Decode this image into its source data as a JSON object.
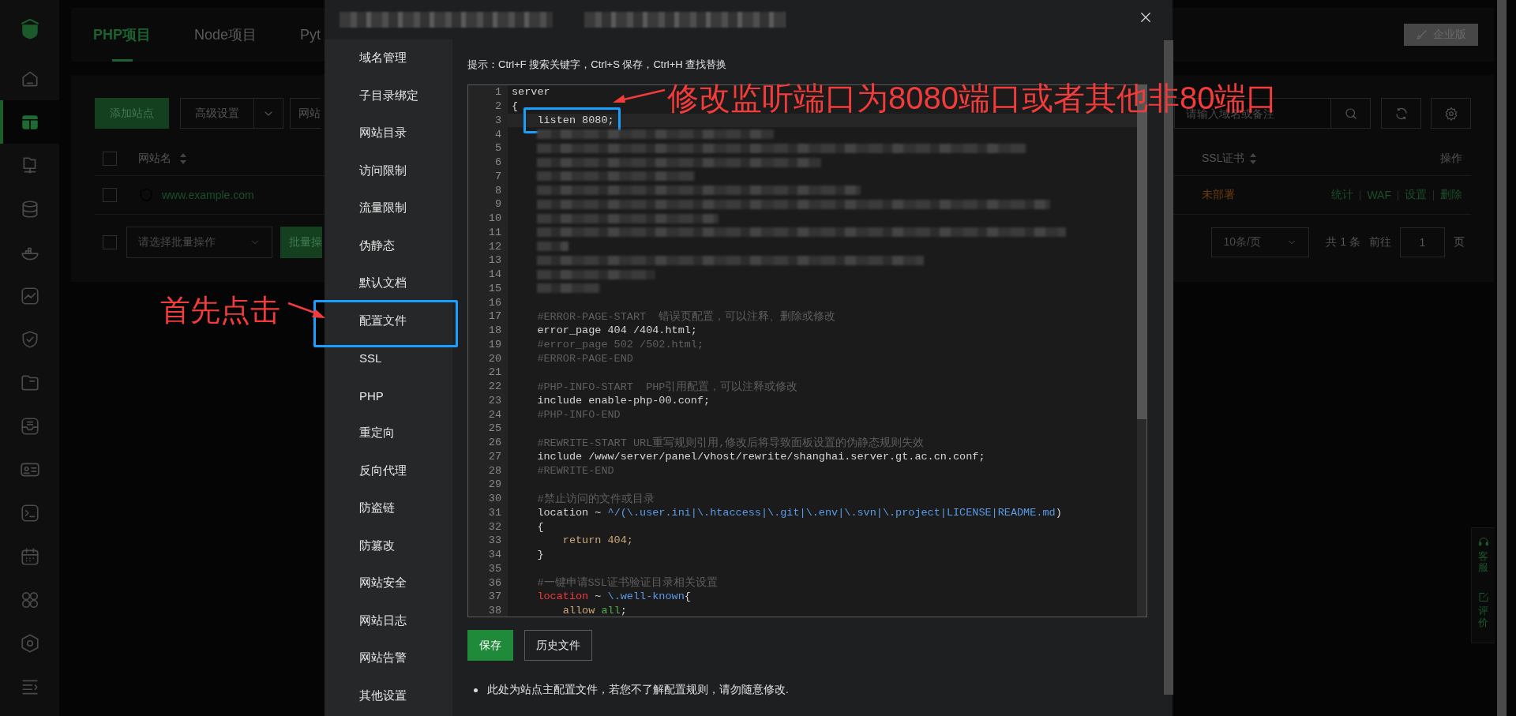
{
  "sidebar": {
    "items": [
      {
        "selected": false
      },
      {
        "selected": true
      },
      {
        "selected": false
      },
      {
        "selected": false
      },
      {
        "selected": false
      },
      {
        "selected": false
      },
      {
        "selected": false
      },
      {
        "selected": false
      },
      {
        "selected": false
      },
      {
        "selected": false
      },
      {
        "selected": false
      },
      {
        "selected": false
      },
      {
        "selected": false
      },
      {
        "selected": false
      },
      {
        "selected": false
      }
    ]
  },
  "tabs": [
    {
      "label": "PHP项目",
      "selected": true
    },
    {
      "label": "Node项目",
      "selected": false
    },
    {
      "label": "Pyt",
      "selected": false
    }
  ],
  "edition_button": "企业版",
  "toolbar": {
    "buttons": [
      "添加站点",
      "高级设置",
      "网站"
    ],
    "search": {
      "placeholder": "请输入域名或备注"
    }
  },
  "table": {
    "header_checked": false,
    "columns": [
      "网站名",
      "SSL证书",
      "操作"
    ],
    "rows": [
      {
        "checked": false,
        "name": "www.example.com",
        "ssl": "未部署",
        "actions": [
          "统计",
          "WAF",
          "设置",
          "删除"
        ]
      }
    ]
  },
  "batch": {
    "checked": false,
    "select_placeholder": "请选择批量操作",
    "button": "批量操"
  },
  "pagination": {
    "page_size": "10条/页",
    "total": "共 1 条",
    "goto_label": "前往",
    "page": "1",
    "page_suffix": "页"
  },
  "float_panel": [
    {
      "label": "客服"
    },
    {
      "label": "评价"
    }
  ],
  "modal": {
    "menu": [
      {
        "label": "域名管理",
        "highlighted": false
      },
      {
        "label": "子目录绑定",
        "highlighted": false
      },
      {
        "label": "网站目录",
        "highlighted": false
      },
      {
        "label": "访问限制",
        "highlighted": false
      },
      {
        "label": "流量限制",
        "highlighted": false
      },
      {
        "label": "伪静态",
        "highlighted": false
      },
      {
        "label": "默认文档",
        "highlighted": false
      },
      {
        "label": "配置文件",
        "highlighted": true
      },
      {
        "label": "SSL",
        "highlighted": false
      },
      {
        "label": "PHP",
        "highlighted": false
      },
      {
        "label": "重定向",
        "highlighted": false
      },
      {
        "label": "反向代理",
        "highlighted": false
      },
      {
        "label": "防盗链",
        "highlighted": false
      },
      {
        "label": "防篡改",
        "highlighted": false
      },
      {
        "label": "网站安全",
        "highlighted": false
      },
      {
        "label": "网站日志",
        "highlighted": false
      },
      {
        "label": "网站告警",
        "highlighted": false
      },
      {
        "label": "其他设置",
        "highlighted": false
      }
    ],
    "hint": "提示：Ctrl+F 搜索关键字，Ctrl+S 保存，Ctrl+H 查找替换",
    "editor": {
      "lines": [
        {
          "number": "1",
          "tokens": [
            {
              "text": "server",
              "kind": "plain"
            }
          ]
        },
        {
          "number": "2",
          "tokens": [
            {
              "text": "{",
              "kind": "plain"
            }
          ]
        },
        {
          "number": "3",
          "active": true,
          "highlighted": true,
          "tokens": [
            {
              "text": "    listen 8080;",
              "kind": "plain"
            }
          ]
        },
        {
          "number": "4",
          "redacted": true
        },
        {
          "number": "5",
          "redacted": true
        },
        {
          "number": "6",
          "redacted": true
        },
        {
          "number": "7",
          "redacted": true
        },
        {
          "number": "8",
          "redacted": true
        },
        {
          "number": "9",
          "redacted": true
        },
        {
          "number": "10",
          "redacted": true
        },
        {
          "number": "11",
          "redacted": true
        },
        {
          "number": "12",
          "redacted": true
        },
        {
          "number": "13",
          "redacted": true
        },
        {
          "number": "14",
          "redacted": true
        },
        {
          "number": "15",
          "redacted": true
        },
        {
          "number": "16"
        },
        {
          "number": "17",
          "tokens": [
            {
              "text": "    #ERROR-PAGE-START  错误页配置，可以注释、删除或修改",
              "kind": "comment"
            }
          ]
        },
        {
          "number": "18",
          "tokens": [
            {
              "text": "    error_page 404 /404.html;",
              "kind": "plain"
            }
          ]
        },
        {
          "number": "19",
          "tokens": [
            {
              "text": "    #error_page 502 /502.html;",
              "kind": "comment"
            }
          ]
        },
        {
          "number": "20",
          "tokens": [
            {
              "text": "    #ERROR-PAGE-END",
              "kind": "comment"
            }
          ]
        },
        {
          "number": "21"
        },
        {
          "number": "22",
          "tokens": [
            {
              "text": "    #PHP-INFO-START  PHP引用配置，可以注释或修改",
              "kind": "comment"
            }
          ]
        },
        {
          "number": "23",
          "tokens": [
            {
              "text": "    include enable-php-00.conf;",
              "kind": "plain"
            }
          ]
        },
        {
          "number": "24",
          "tokens": [
            {
              "text": "    #PHP-INFO-END",
              "kind": "comment"
            }
          ]
        },
        {
          "number": "25"
        },
        {
          "number": "26",
          "tokens": [
            {
              "text": "    #REWRITE-START URL重写规则引用,修改后将导致面板设置的伪静态规则失效",
              "kind": "comment"
            }
          ]
        },
        {
          "number": "27",
          "tokens": [
            {
              "text": "    include /www/server/panel/vhost/rewrite/shanghai.server.gt.ac.cn.conf;",
              "kind": "plain"
            }
          ]
        },
        {
          "number": "28",
          "tokens": [
            {
              "text": "    #REWRITE-END",
              "kind": "comment"
            }
          ]
        },
        {
          "number": "29"
        },
        {
          "number": "30",
          "tokens": [
            {
              "text": "    #禁止访问的文件或目录",
              "kind": "comment"
            }
          ]
        },
        {
          "number": "31",
          "tokens": [
            {
              "text": "    location ~ ",
              "kind": "plain"
            },
            {
              "text": "^/(\\.user.ini|\\.htaccess|\\.git|\\.env|\\.svn|\\.project|LICENSE|README.md",
              "kind": "regex"
            },
            {
              "text": ")",
              "kind": "plain"
            }
          ]
        },
        {
          "number": "32",
          "tokens": [
            {
              "text": "    {",
              "kind": "plain"
            }
          ]
        },
        {
          "number": "33",
          "tokens": [
            {
              "text": "        return 404;",
              "kind": "keyword"
            }
          ]
        },
        {
          "number": "34",
          "tokens": [
            {
              "text": "    }",
              "kind": "plain"
            }
          ]
        },
        {
          "number": "35"
        },
        {
          "number": "36",
          "tokens": [
            {
              "text": "    #一键申请SSL证书验证目录相关设置",
              "kind": "comment"
            }
          ]
        },
        {
          "number": "37",
          "tokens": [
            {
              "text": "    location",
              "kind": "error"
            },
            {
              "text": " ~ ",
              "kind": "plain"
            },
            {
              "text": "\\.well-known",
              "kind": "regex"
            },
            {
              "text": "{",
              "kind": "plain"
            }
          ]
        },
        {
          "number": "38",
          "tokens": [
            {
              "text": "        allow",
              "kind": "keyword"
            },
            {
              "text": " all",
              "kind": "value"
            },
            {
              "text": ";",
              "kind": "plain"
            }
          ]
        }
      ]
    },
    "buttons": [
      {
        "label": "保存",
        "kind": "primary"
      },
      {
        "label": "历史文件",
        "kind": "default"
      }
    ],
    "note": "此处为站点主配置文件，若您不了解配置规则，请勿随意修改."
  },
  "annotations": [
    {
      "text": "修改监听端口为8080端口或者其他非80端口"
    },
    {
      "text": "首先点击"
    }
  ]
}
